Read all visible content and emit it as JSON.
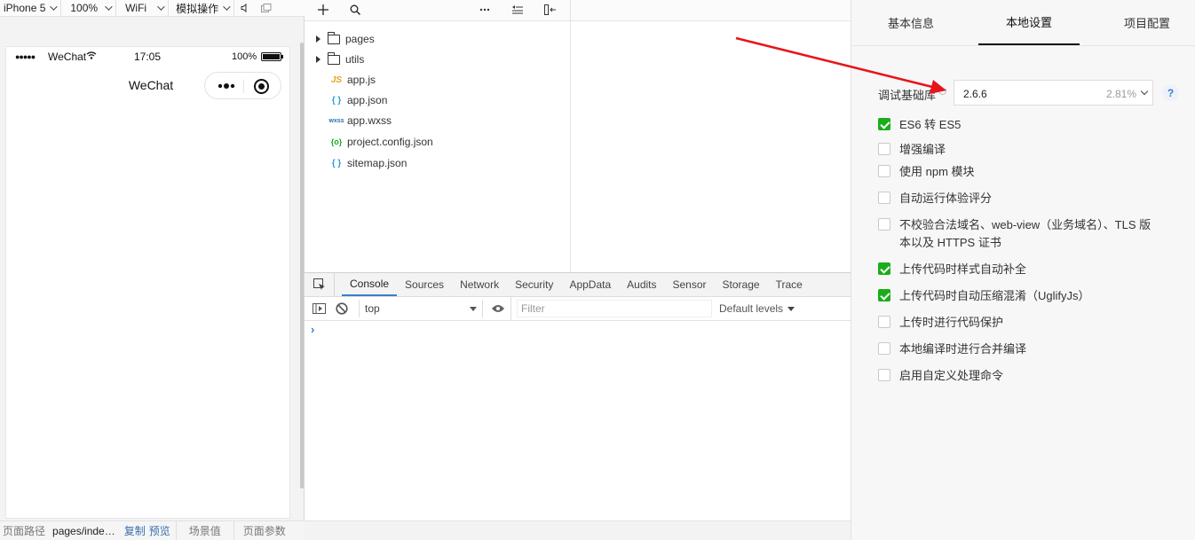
{
  "simulator": {
    "toolbar": {
      "device": "iPhone 5",
      "zoom": "100%",
      "network": "WiFi",
      "operations": "模拟操作"
    },
    "status_bar": {
      "dots": "●●●●●",
      "carrier": "WeChat",
      "time": "17:05",
      "battery": "100%"
    },
    "navbar_title": "WeChat"
  },
  "pathbar": {
    "path_label": "页面路径",
    "path_value": "pages/inde…",
    "copy": "复制",
    "preview": "预览",
    "scene": "场景值",
    "params": "页面参数"
  },
  "file_tree": {
    "items": [
      {
        "name": "pages",
        "type": "folder"
      },
      {
        "name": "utils",
        "type": "folder"
      },
      {
        "name": "app.js",
        "type": "js",
        "badge": "JS",
        "color": "#e8a321"
      },
      {
        "name": "app.json",
        "type": "json",
        "badge": "{ }",
        "color": "#2a9fd6"
      },
      {
        "name": "app.wxss",
        "type": "wxss",
        "badge": "wxss",
        "color": "#2a6fb5"
      },
      {
        "name": "project.config.json",
        "type": "config",
        "badge": "{o}",
        "color": "#1aad19"
      },
      {
        "name": "sitemap.json",
        "type": "json",
        "badge": "{ }",
        "color": "#2a9fd6"
      }
    ]
  },
  "devtools": {
    "tabs": [
      "Console",
      "Sources",
      "Network",
      "Security",
      "AppData",
      "Audits",
      "Sensor",
      "Storage",
      "Trace"
    ],
    "active_tab": "Console",
    "context": "top",
    "filter_placeholder": "Filter",
    "levels": "Default levels",
    "prompt": "›"
  },
  "settings": {
    "tabs": [
      "基本信息",
      "本地设置",
      "项目配置"
    ],
    "active_tab": "本地设置",
    "library": {
      "label": "调试基础库",
      "version": "2.6.6",
      "percent": "2.81%",
      "help": "?"
    },
    "options": [
      {
        "label": "ES6 转 ES5",
        "checked": true
      },
      {
        "label": "增强编译",
        "checked": false
      },
      {
        "label": "使用 npm 模块",
        "checked": false
      },
      {
        "label": "自动运行体验评分",
        "checked": false
      },
      {
        "label": "不校验合法域名、web-view（业务域名）、TLS 版本以及 HTTPS 证书",
        "checked": false
      },
      {
        "label": "上传代码时样式自动补全",
        "checked": true
      },
      {
        "label": "上传代码时自动压缩混淆（UglifyJs）",
        "checked": true
      },
      {
        "label": "上传时进行代码保护",
        "checked": false
      },
      {
        "label": "本地编译时进行合并编译",
        "checked": false
      },
      {
        "label": "启用自定义处理命令",
        "checked": false
      }
    ]
  },
  "colors": {
    "accent_green": "#1aad19",
    "annotation_arrow": "#e8141b",
    "link_blue": "#3a6fb0"
  }
}
